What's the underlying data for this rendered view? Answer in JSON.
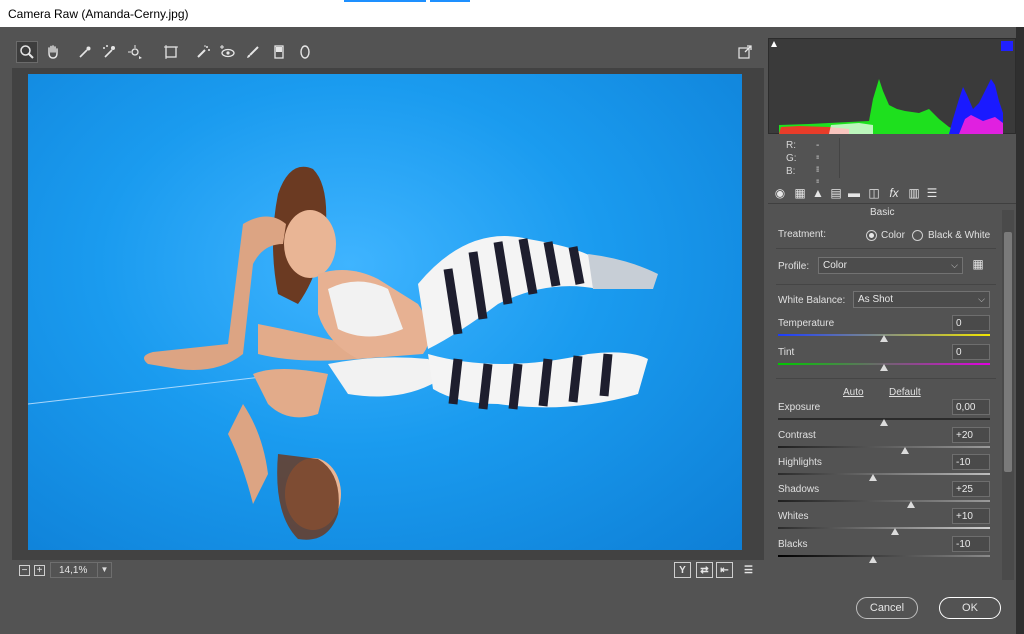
{
  "window": {
    "title": "Camera Raw (Amanda-Cerny.jpg)"
  },
  "toolbar": {
    "tools": [
      "zoom-tool",
      "hand-tool",
      "white-balance-tool",
      "color-sampler-tool",
      "targeted-adjustment-tool",
      "transform-tool",
      "spot-removal-tool",
      "red-eye-tool",
      "adjustment-brush-tool",
      "graduated-filter-tool",
      "radial-filter-tool"
    ]
  },
  "status": {
    "zoom": "14,1%",
    "view_buttons": [
      "Y"
    ]
  },
  "histogram": {
    "r_label": "R:",
    "g_label": "G:",
    "b_label": "B:",
    "r_value": "---",
    "g_value": "---",
    "b_value": "---"
  },
  "panel": {
    "title": "Basic",
    "treatment_label": "Treatment:",
    "treatment_options": [
      "Color",
      "Black & White"
    ],
    "treatment_selected": "Color",
    "profile_label": "Profile:",
    "profile_value": "Color",
    "white_balance_label": "White Balance:",
    "white_balance_value": "As Shot",
    "auto_label": "Auto",
    "default_label": "Default",
    "sliders": [
      {
        "label": "Temperature",
        "value": "0",
        "level": 0.5
      },
      {
        "label": "Tint",
        "value": "0",
        "level": 0.5
      },
      {
        "label": "Exposure",
        "value": "0,00",
        "level": 0.5
      },
      {
        "label": "Contrast",
        "value": "+20",
        "level": 0.6
      },
      {
        "label": "Highlights",
        "value": "-10",
        "level": 0.45
      },
      {
        "label": "Shadows",
        "value": "+25",
        "level": 0.625
      },
      {
        "label": "Whites",
        "value": "+10",
        "level": 0.55
      },
      {
        "label": "Blacks",
        "value": "-10",
        "level": 0.45
      }
    ]
  },
  "dialog": {
    "cancel_label": "Cancel",
    "ok_label": "OK"
  },
  "colors": {
    "photo_background": "#1a9bef",
    "ui_background": "#535353",
    "title_stripe": "#1e90ff"
  }
}
